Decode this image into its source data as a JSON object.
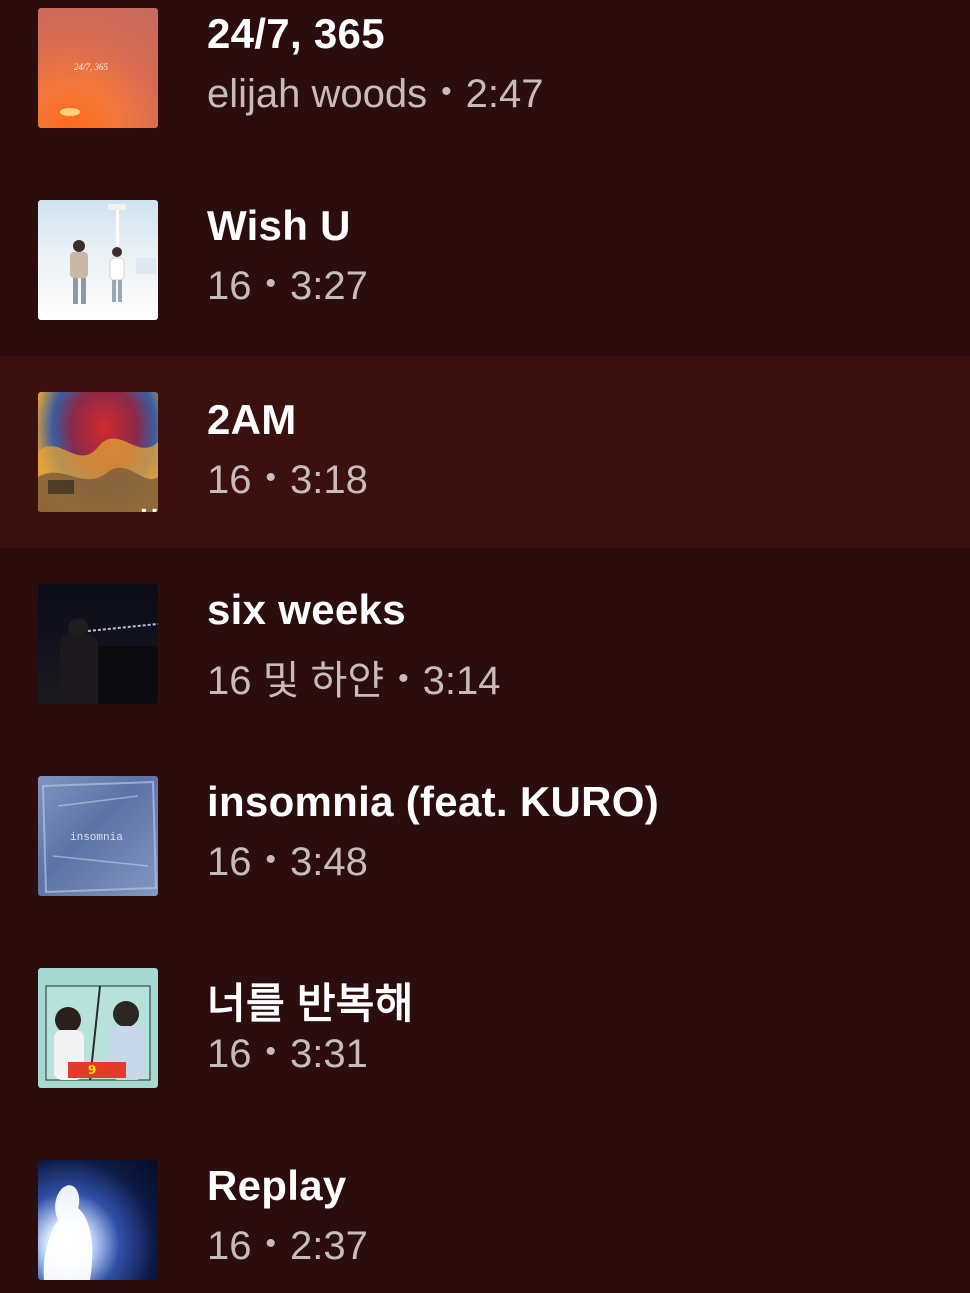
{
  "tracks": [
    {
      "title": "24/7, 365",
      "artist": "elijah woods",
      "duration": "2:47",
      "art_icon": "album-art-sunset",
      "art_text": "24/7, 365"
    },
    {
      "title": "Wish U",
      "artist": "16",
      "duration": "3:27",
      "art_icon": "album-art-snow-couple"
    },
    {
      "title": "2AM",
      "artist": "16",
      "duration": "3:18",
      "art_icon": "album-art-abstract-colors",
      "active": true,
      "more_label": "..."
    },
    {
      "title": "six weeks",
      "artist": "16 및 하얀",
      "duration": "3:14",
      "art_icon": "album-art-night-portrait"
    },
    {
      "title": "insomnia (feat. KURO)",
      "artist": "16",
      "duration": "3:48",
      "art_icon": "album-art-blue-plastic",
      "art_text": "insomnia"
    },
    {
      "title": "너를 반복해",
      "artist": "16",
      "duration": "3:31",
      "art_icon": "album-art-drama-poster"
    },
    {
      "title": "Replay",
      "artist": "16",
      "duration": "2:37",
      "art_icon": "album-art-bright-figure"
    }
  ],
  "separator": "•",
  "colors": {
    "background": "#2a0d0c",
    "active_row": "#3a110f",
    "title": "#ffffff",
    "meta": "#c8bbbb"
  }
}
